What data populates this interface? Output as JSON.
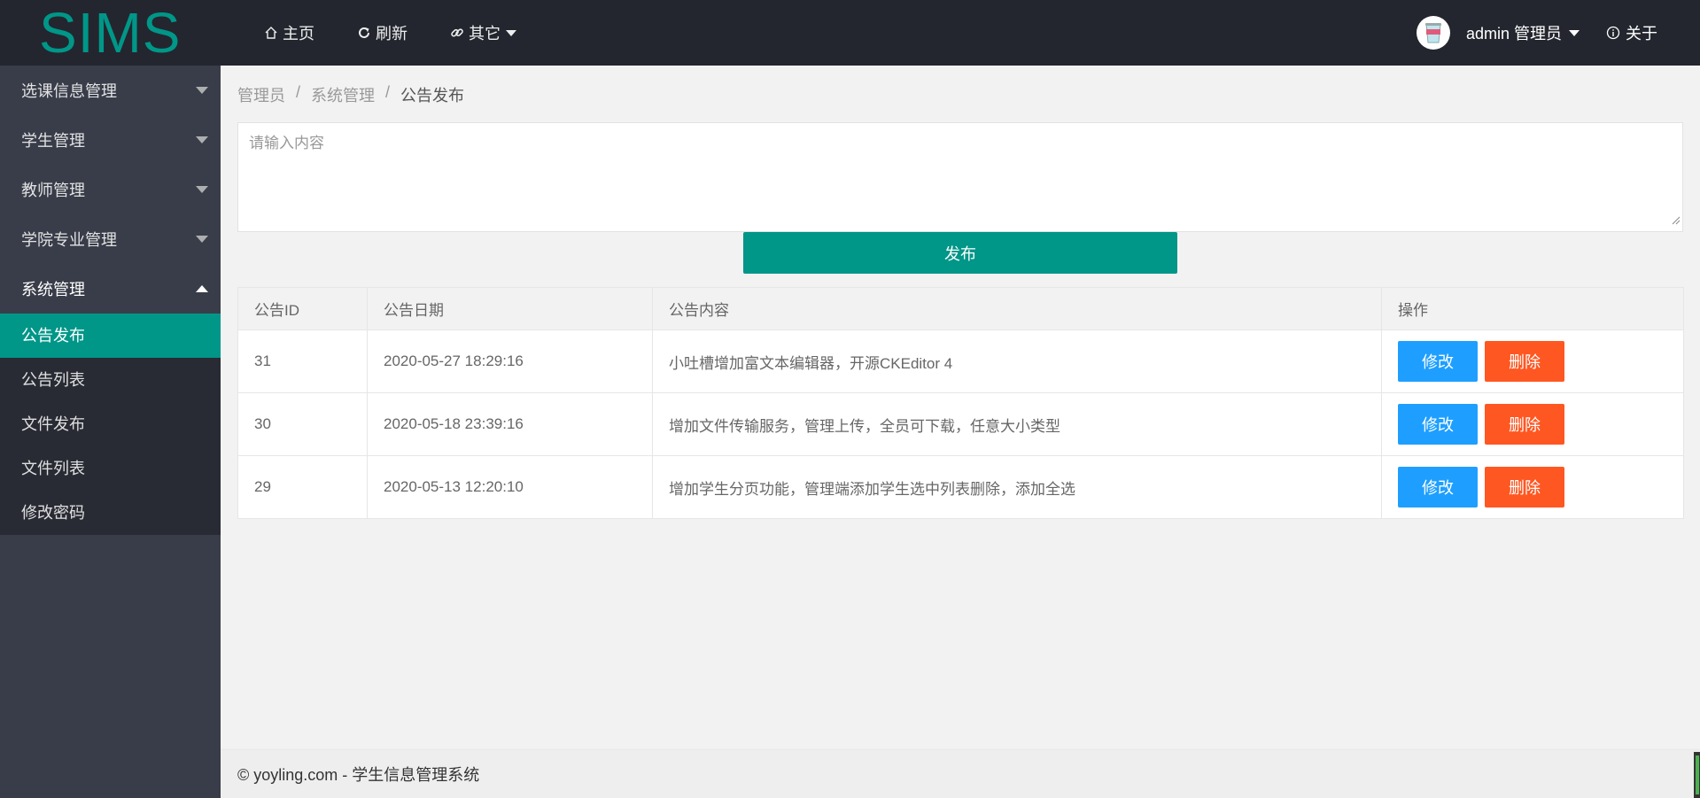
{
  "header": {
    "logo": "SIMS",
    "nav": [
      {
        "label": "主页"
      },
      {
        "label": "刷新"
      },
      {
        "label": "其它"
      }
    ],
    "user_label": "admin 管理员",
    "about_label": "关于"
  },
  "sidebar": {
    "groups": [
      {
        "label": "选课信息管理"
      },
      {
        "label": "学生管理"
      },
      {
        "label": "教师管理"
      },
      {
        "label": "学院专业管理"
      },
      {
        "label": "系统管理"
      }
    ],
    "sub_items": [
      {
        "label": "公告发布"
      },
      {
        "label": "公告列表"
      },
      {
        "label": "文件发布"
      },
      {
        "label": "文件列表"
      },
      {
        "label": "修改密码"
      }
    ]
  },
  "breadcrumb": [
    "管理员",
    "系统管理",
    "公告发布"
  ],
  "editor": {
    "placeholder": "请输入内容",
    "value": ""
  },
  "publish_label": "发布",
  "table": {
    "columns": [
      "公告ID",
      "公告日期",
      "公告内容",
      "操作"
    ],
    "rows": [
      {
        "id": "31",
        "date": "2020-05-27 18:29:16",
        "content": "小吐槽增加富文本编辑器，开源CKEditor 4"
      },
      {
        "id": "30",
        "date": "2020-05-18 23:39:16",
        "content": "增加文件传输服务，管理上传，全员可下载，任意大小类型"
      },
      {
        "id": "29",
        "date": "2020-05-13 12:20:10",
        "content": "增加学生分页功能，管理端添加学生选中列表删除，添加全选"
      }
    ],
    "edit_label": "修改",
    "delete_label": "删除"
  },
  "footer": "© yoyling.com - 学生信息管理系统",
  "colors": {
    "accent": "#009688",
    "edit": "#1e9fff",
    "delete": "#ff5722",
    "header_bg": "#23262e",
    "sidebar_bg": "#393d49"
  }
}
